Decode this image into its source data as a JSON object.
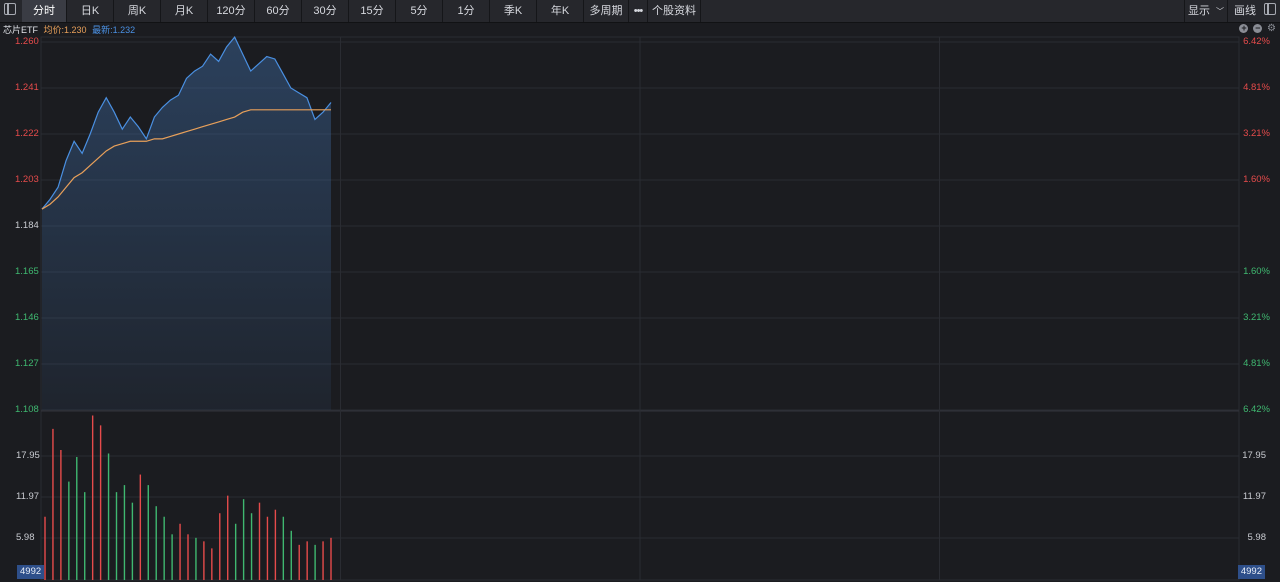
{
  "toolbar": {
    "tabs": [
      "分时",
      "日K",
      "周K",
      "月K",
      "120分",
      "60分",
      "30分",
      "15分",
      "5分",
      "1分",
      "季K",
      "年K",
      "多周期"
    ],
    "more": "•••",
    "profile": "个股资料",
    "display": "显示",
    "draw": "画线"
  },
  "info": {
    "name": "芯片ETF",
    "avg": "均价:1.230",
    "latest": "最新:1.232"
  },
  "tools": {
    "plus": "+",
    "minus": "−",
    "gear": "⚙"
  },
  "colors": {
    "up": "#e64b4b",
    "down": "#3fb870",
    "neutral": "#c9cbd1",
    "price": "#4a90e2",
    "avg": "#e8a05a",
    "grid": "#2a2c32"
  },
  "axes": {
    "price_left": [
      {
        "label": "1.260",
        "tone": "up"
      },
      {
        "label": "1.241",
        "tone": "up"
      },
      {
        "label": "1.222",
        "tone": "up"
      },
      {
        "label": "1.203",
        "tone": "up"
      },
      {
        "label": "1.184",
        "tone": "neutral"
      },
      {
        "label": "1.165",
        "tone": "down"
      },
      {
        "label": "1.146",
        "tone": "down"
      },
      {
        "label": "1.127",
        "tone": "down"
      },
      {
        "label": "1.108",
        "tone": "down"
      }
    ],
    "pct_right": [
      {
        "label": "6.42%",
        "tone": "up"
      },
      {
        "label": "4.81%",
        "tone": "up"
      },
      {
        "label": "3.21%",
        "tone": "up"
      },
      {
        "label": "1.60%",
        "tone": "up"
      },
      {
        "label": "",
        "tone": "neutral"
      },
      {
        "label": "1.60%",
        "tone": "down"
      },
      {
        "label": "3.21%",
        "tone": "down"
      },
      {
        "label": "4.81%",
        "tone": "down"
      },
      {
        "label": "6.42%",
        "tone": "down"
      }
    ],
    "vol": [
      "17.95",
      "11.97",
      "5.98"
    ],
    "vol_badge": "4992"
  },
  "chart_data": {
    "type": "line",
    "price_range": [
      1.108,
      1.26
    ],
    "volume_range": [
      0,
      23.9
    ],
    "total_minutes": 240,
    "series": [
      {
        "name": "最新",
        "values": [
          1.191,
          1.195,
          1.2,
          1.211,
          1.219,
          1.214,
          1.222,
          1.231,
          1.237,
          1.231,
          1.224,
          1.229,
          1.225,
          1.22,
          1.229,
          1.233,
          1.236,
          1.238,
          1.245,
          1.248,
          1.25,
          1.255,
          1.252,
          1.258,
          1.262,
          1.255,
          1.248,
          1.251,
          1.254,
          1.253,
          1.247,
          1.241,
          1.239,
          1.237,
          1.228,
          1.231,
          1.235
        ]
      },
      {
        "name": "均价",
        "values": [
          1.191,
          1.193,
          1.196,
          1.2,
          1.204,
          1.206,
          1.209,
          1.212,
          1.215,
          1.217,
          1.218,
          1.219,
          1.219,
          1.219,
          1.22,
          1.22,
          1.221,
          1.222,
          1.223,
          1.224,
          1.225,
          1.226,
          1.227,
          1.228,
          1.229,
          1.231,
          1.232,
          1.232,
          1.232,
          1.232,
          1.232,
          1.232,
          1.232,
          1.232,
          1.232,
          1.232,
          1.232
        ]
      }
    ],
    "volume": [
      {
        "v": 9.0,
        "c": "up"
      },
      {
        "v": 21.5,
        "c": "up"
      },
      {
        "v": 18.5,
        "c": "up"
      },
      {
        "v": 14.0,
        "c": "down"
      },
      {
        "v": 17.5,
        "c": "down"
      },
      {
        "v": 12.5,
        "c": "down"
      },
      {
        "v": 23.4,
        "c": "up"
      },
      {
        "v": 22.0,
        "c": "up"
      },
      {
        "v": 18.0,
        "c": "down"
      },
      {
        "v": 12.5,
        "c": "down"
      },
      {
        "v": 13.5,
        "c": "down"
      },
      {
        "v": 11.0,
        "c": "down"
      },
      {
        "v": 15.0,
        "c": "up"
      },
      {
        "v": 13.5,
        "c": "down"
      },
      {
        "v": 10.5,
        "c": "down"
      },
      {
        "v": 9.0,
        "c": "down"
      },
      {
        "v": 6.5,
        "c": "down"
      },
      {
        "v": 8.0,
        "c": "up"
      },
      {
        "v": 6.5,
        "c": "up"
      },
      {
        "v": 6.0,
        "c": "down"
      },
      {
        "v": 5.5,
        "c": "up"
      },
      {
        "v": 4.5,
        "c": "up"
      },
      {
        "v": 9.5,
        "c": "up"
      },
      {
        "v": 12.0,
        "c": "up"
      },
      {
        "v": 8.0,
        "c": "down"
      },
      {
        "v": 11.5,
        "c": "down"
      },
      {
        "v": 9.5,
        "c": "down"
      },
      {
        "v": 11.0,
        "c": "up"
      },
      {
        "v": 9.0,
        "c": "up"
      },
      {
        "v": 10.0,
        "c": "up"
      },
      {
        "v": 9.0,
        "c": "down"
      },
      {
        "v": 7.0,
        "c": "down"
      },
      {
        "v": 5.0,
        "c": "up"
      },
      {
        "v": 5.5,
        "c": "up"
      },
      {
        "v": 5.0,
        "c": "down"
      },
      {
        "v": 5.5,
        "c": "up"
      },
      {
        "v": 6.0,
        "c": "up"
      }
    ]
  }
}
